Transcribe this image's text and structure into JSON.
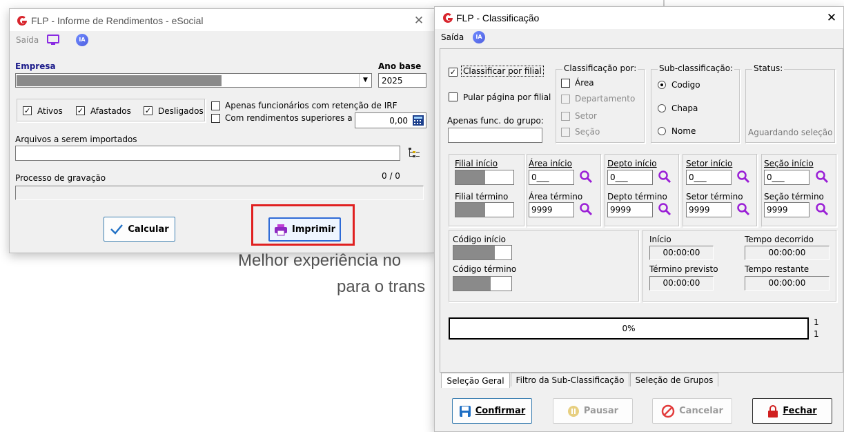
{
  "background": {
    "line1": "Melhor experiência no",
    "line2": "para o trans"
  },
  "win1": {
    "title": "FLP - Informe de Rendimentos -  eSocial",
    "close": "✕",
    "menu_saida": "Saída",
    "ia": "IA",
    "empresa_label": "Empresa",
    "ano_base_label": "Ano base",
    "ano_base_value": "2025",
    "chk_ativos": "Ativos",
    "chk_afastados": "Afastados",
    "chk_desligados": "Desligados",
    "chk_retencao": "Apenas funcionários com retenção de IRF",
    "chk_rendimentos": "Com rendimentos superiores a",
    "valor": "0,00",
    "arquivos_label": "Arquivos a serem importados",
    "processo_label": "Processo de gravação",
    "processo_count": "0 / 0",
    "btn_calcular": "Calcular",
    "btn_imprimir": "Imprimir",
    "highlight_color": "#e02020"
  },
  "win2": {
    "title": "FLP - Classificação",
    "close": "✕",
    "menu_saida": "Saída",
    "ia": "IA",
    "chk_classificar": "Classificar por filial",
    "chk_pular": "Pular página por filial",
    "apenas_func_label": "Apenas func. do grupo:",
    "class_por": {
      "title": "Classificação  por:",
      "area": "Área",
      "departamento": "Departamento",
      "setor": "Setor",
      "secao": "Seção"
    },
    "sub_class": {
      "title": "Sub-classificação:",
      "codigo": "Codigo",
      "chapa": "Chapa",
      "nome": "Nome"
    },
    "status": {
      "title": "Status:",
      "value": "Aguardando seleção"
    },
    "ranges": {
      "filial_inicio": "Filial início",
      "filial_termino": "Filial término",
      "area_inicio": "Área início",
      "area_termino": "Área término",
      "depto_inicio": "Depto início",
      "depto_termino": "Depto término",
      "setor_inicio": "Setor início",
      "setor_termino": "Setor término",
      "secao_inicio": "Seção início",
      "secao_termino": "Seção término",
      "inicio_value": "0___",
      "termino_value": "9999"
    },
    "codigo_inicio": "Código início",
    "codigo_termino": "Código término",
    "tempo": {
      "inicio_label": "Início",
      "decorrido_label": "Tempo decorrido",
      "previsto_label": "Término previsto",
      "restante_label": "Tempo restante",
      "inicio_value": "00:00:00",
      "decorrido_value": "00:00:00",
      "previsto_value": "00:00:00",
      "restante_value": "00:00:00"
    },
    "progress_text": "0%",
    "progress_side_1": "1",
    "progress_side_2": "1",
    "tabs": [
      "Seleção Geral",
      "Filtro da Sub-Classificação",
      "Seleção de Grupos"
    ],
    "btn_confirmar": "Confirmar",
    "btn_pausar": "Pausar",
    "btn_cancelar": "Cancelar",
    "btn_fechar": "Fechar"
  }
}
